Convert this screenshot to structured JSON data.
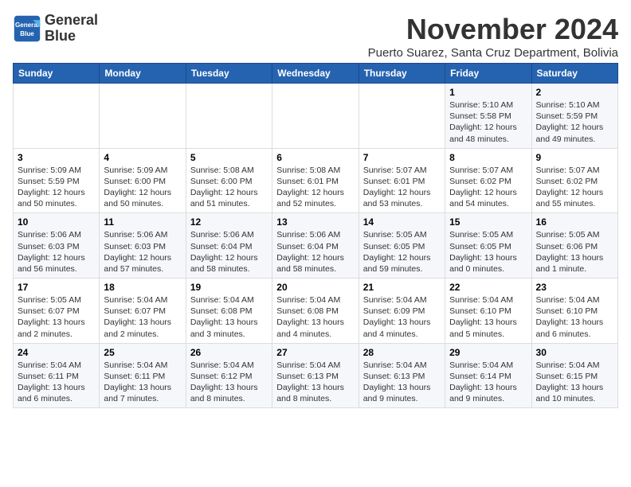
{
  "logo": {
    "line1": "General",
    "line2": "Blue"
  },
  "title": "November 2024",
  "subtitle": "Puerto Suarez, Santa Cruz Department, Bolivia",
  "weekdays": [
    "Sunday",
    "Monday",
    "Tuesday",
    "Wednesday",
    "Thursday",
    "Friday",
    "Saturday"
  ],
  "weeks": [
    [
      {
        "day": "",
        "info": ""
      },
      {
        "day": "",
        "info": ""
      },
      {
        "day": "",
        "info": ""
      },
      {
        "day": "",
        "info": ""
      },
      {
        "day": "",
        "info": ""
      },
      {
        "day": "1",
        "info": "Sunrise: 5:10 AM\nSunset: 5:58 PM\nDaylight: 12 hours and 48 minutes."
      },
      {
        "day": "2",
        "info": "Sunrise: 5:10 AM\nSunset: 5:59 PM\nDaylight: 12 hours and 49 minutes."
      }
    ],
    [
      {
        "day": "3",
        "info": "Sunrise: 5:09 AM\nSunset: 5:59 PM\nDaylight: 12 hours and 50 minutes."
      },
      {
        "day": "4",
        "info": "Sunrise: 5:09 AM\nSunset: 6:00 PM\nDaylight: 12 hours and 50 minutes."
      },
      {
        "day": "5",
        "info": "Sunrise: 5:08 AM\nSunset: 6:00 PM\nDaylight: 12 hours and 51 minutes."
      },
      {
        "day": "6",
        "info": "Sunrise: 5:08 AM\nSunset: 6:01 PM\nDaylight: 12 hours and 52 minutes."
      },
      {
        "day": "7",
        "info": "Sunrise: 5:07 AM\nSunset: 6:01 PM\nDaylight: 12 hours and 53 minutes."
      },
      {
        "day": "8",
        "info": "Sunrise: 5:07 AM\nSunset: 6:02 PM\nDaylight: 12 hours and 54 minutes."
      },
      {
        "day": "9",
        "info": "Sunrise: 5:07 AM\nSunset: 6:02 PM\nDaylight: 12 hours and 55 minutes."
      }
    ],
    [
      {
        "day": "10",
        "info": "Sunrise: 5:06 AM\nSunset: 6:03 PM\nDaylight: 12 hours and 56 minutes."
      },
      {
        "day": "11",
        "info": "Sunrise: 5:06 AM\nSunset: 6:03 PM\nDaylight: 12 hours and 57 minutes."
      },
      {
        "day": "12",
        "info": "Sunrise: 5:06 AM\nSunset: 6:04 PM\nDaylight: 12 hours and 58 minutes."
      },
      {
        "day": "13",
        "info": "Sunrise: 5:06 AM\nSunset: 6:04 PM\nDaylight: 12 hours and 58 minutes."
      },
      {
        "day": "14",
        "info": "Sunrise: 5:05 AM\nSunset: 6:05 PM\nDaylight: 12 hours and 59 minutes."
      },
      {
        "day": "15",
        "info": "Sunrise: 5:05 AM\nSunset: 6:05 PM\nDaylight: 13 hours and 0 minutes."
      },
      {
        "day": "16",
        "info": "Sunrise: 5:05 AM\nSunset: 6:06 PM\nDaylight: 13 hours and 1 minute."
      }
    ],
    [
      {
        "day": "17",
        "info": "Sunrise: 5:05 AM\nSunset: 6:07 PM\nDaylight: 13 hours and 2 minutes."
      },
      {
        "day": "18",
        "info": "Sunrise: 5:04 AM\nSunset: 6:07 PM\nDaylight: 13 hours and 2 minutes."
      },
      {
        "day": "19",
        "info": "Sunrise: 5:04 AM\nSunset: 6:08 PM\nDaylight: 13 hours and 3 minutes."
      },
      {
        "day": "20",
        "info": "Sunrise: 5:04 AM\nSunset: 6:08 PM\nDaylight: 13 hours and 4 minutes."
      },
      {
        "day": "21",
        "info": "Sunrise: 5:04 AM\nSunset: 6:09 PM\nDaylight: 13 hours and 4 minutes."
      },
      {
        "day": "22",
        "info": "Sunrise: 5:04 AM\nSunset: 6:10 PM\nDaylight: 13 hours and 5 minutes."
      },
      {
        "day": "23",
        "info": "Sunrise: 5:04 AM\nSunset: 6:10 PM\nDaylight: 13 hours and 6 minutes."
      }
    ],
    [
      {
        "day": "24",
        "info": "Sunrise: 5:04 AM\nSunset: 6:11 PM\nDaylight: 13 hours and 6 minutes."
      },
      {
        "day": "25",
        "info": "Sunrise: 5:04 AM\nSunset: 6:11 PM\nDaylight: 13 hours and 7 minutes."
      },
      {
        "day": "26",
        "info": "Sunrise: 5:04 AM\nSunset: 6:12 PM\nDaylight: 13 hours and 8 minutes."
      },
      {
        "day": "27",
        "info": "Sunrise: 5:04 AM\nSunset: 6:13 PM\nDaylight: 13 hours and 8 minutes."
      },
      {
        "day": "28",
        "info": "Sunrise: 5:04 AM\nSunset: 6:13 PM\nDaylight: 13 hours and 9 minutes."
      },
      {
        "day": "29",
        "info": "Sunrise: 5:04 AM\nSunset: 6:14 PM\nDaylight: 13 hours and 9 minutes."
      },
      {
        "day": "30",
        "info": "Sunrise: 5:04 AM\nSunset: 6:15 PM\nDaylight: 13 hours and 10 minutes."
      }
    ]
  ]
}
